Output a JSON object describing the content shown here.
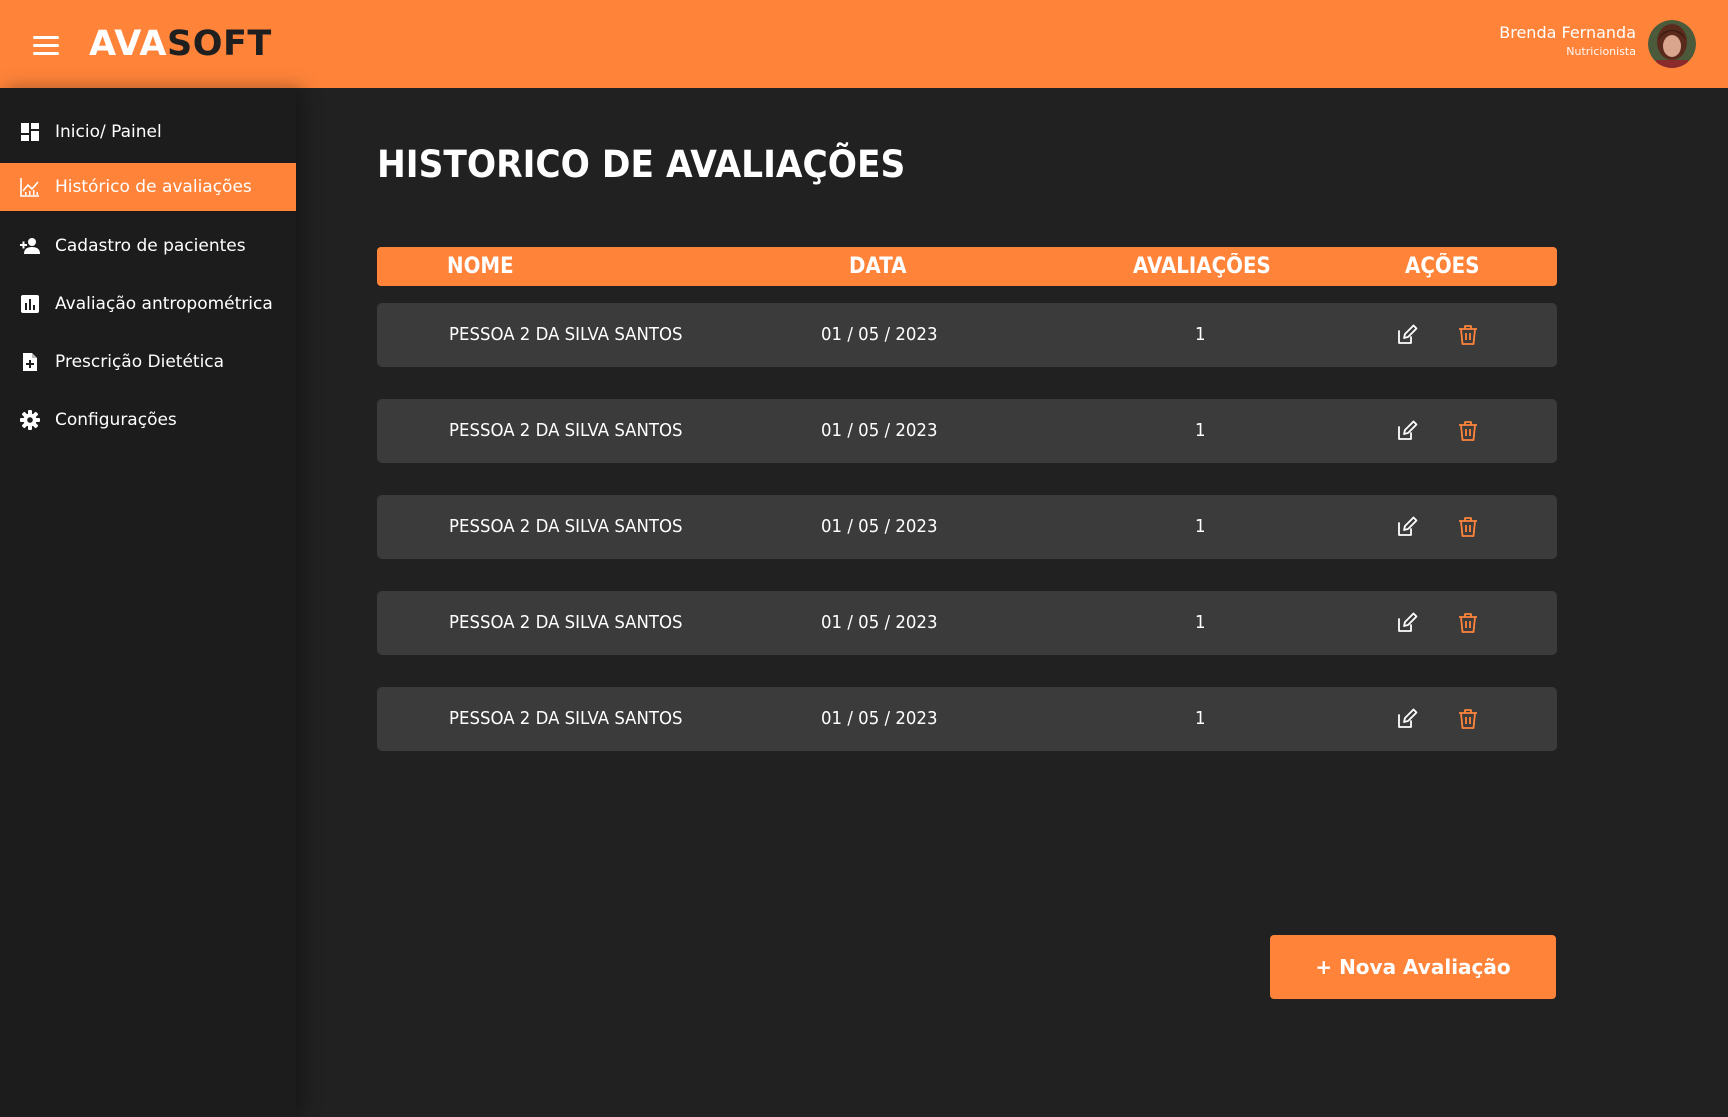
{
  "header": {
    "logo_part1": "AVA",
    "logo_part2": "SOFT",
    "user_name": "Brenda Fernanda",
    "user_role": "Nutricionista",
    "menu_icon": "hamburger-menu-icon"
  },
  "sidebar": {
    "items": [
      {
        "label": "Inicio/ Painel",
        "icon": "dashboard-grid-icon",
        "active": false
      },
      {
        "label": "Histórico de avaliações",
        "icon": "line-chart-icon",
        "active": true
      },
      {
        "label": "Cadastro de pacientes",
        "icon": "add-person-icon",
        "active": false
      },
      {
        "label": "Avaliação antropométrica",
        "icon": "bar-chart-icon",
        "active": false
      },
      {
        "label": "Prescrição Dietética",
        "icon": "add-document-icon",
        "active": false
      },
      {
        "label": "Configurações",
        "icon": "gear-icon",
        "active": false
      }
    ]
  },
  "main": {
    "title": "HISTORICO DE AVALIAÇÕES",
    "table": {
      "headers": [
        "NOME",
        "DATA",
        "AVALIAÇÕES",
        "AÇÕES"
      ],
      "rows": [
        {
          "nome": "PESSOA 2 DA SILVA SANTOS",
          "data": "01 / 05 / 2023",
          "avaliacoes": "1"
        },
        {
          "nome": "PESSOA 2 DA SILVA SANTOS",
          "data": "01 / 05 / 2023",
          "avaliacoes": "1"
        },
        {
          "nome": "PESSOA 2 DA SILVA SANTOS",
          "data": "01 / 05 / 2023",
          "avaliacoes": "1"
        },
        {
          "nome": "PESSOA 2 DA SILVA SANTOS",
          "data": "01 / 05 / 2023",
          "avaliacoes": "1"
        },
        {
          "nome": "PESSOA 2 DA SILVA SANTOS",
          "data": "01 / 05 / 2023",
          "avaliacoes": "1"
        }
      ]
    },
    "new_button_label": "+ Nova Avaliação"
  },
  "colors": {
    "accent": "#ff843a",
    "background": "#212121",
    "sidebar": "#1c1c1c",
    "row": "#3b3b3b",
    "logo_dark": "#1f1f1f"
  }
}
